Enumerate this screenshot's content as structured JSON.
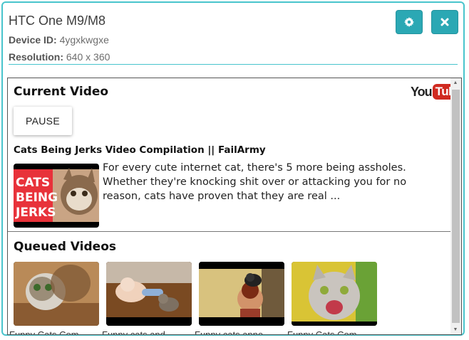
{
  "device": {
    "title": "HTC One M9/M8",
    "id_label": "Device ID:",
    "id_value": "4ygxkwgxe",
    "resolution_label": "Resolution:",
    "resolution_value": "640 x 360"
  },
  "buttons": {
    "settings_icon": "gear-icon",
    "close_icon": "close-icon"
  },
  "current": {
    "heading": "Current Video",
    "logo_you": "You",
    "logo_tube": "Tube",
    "pause_label": "PAUSE",
    "video_title": "Cats Being Jerks Video Compilation || FailArmy",
    "description": "For every cute internet cat, there's 5 more being assholes. Whether they're knocking shit over or attacking you for no reason, cats have proven that they are real ...",
    "thumb_text": [
      "CATS",
      "BEING",
      "JERKS"
    ]
  },
  "queued": {
    "heading": "Queued Videos",
    "items": [
      {
        "label": "Funny Cats Com"
      },
      {
        "label": "Funny cats and"
      },
      {
        "label": "Funny cats anno"
      },
      {
        "label": "Funny Cats Com"
      }
    ]
  },
  "colors": {
    "accent": "#2ba8b4",
    "border": "#48c4cc",
    "youtube_red": "#d02a20"
  }
}
